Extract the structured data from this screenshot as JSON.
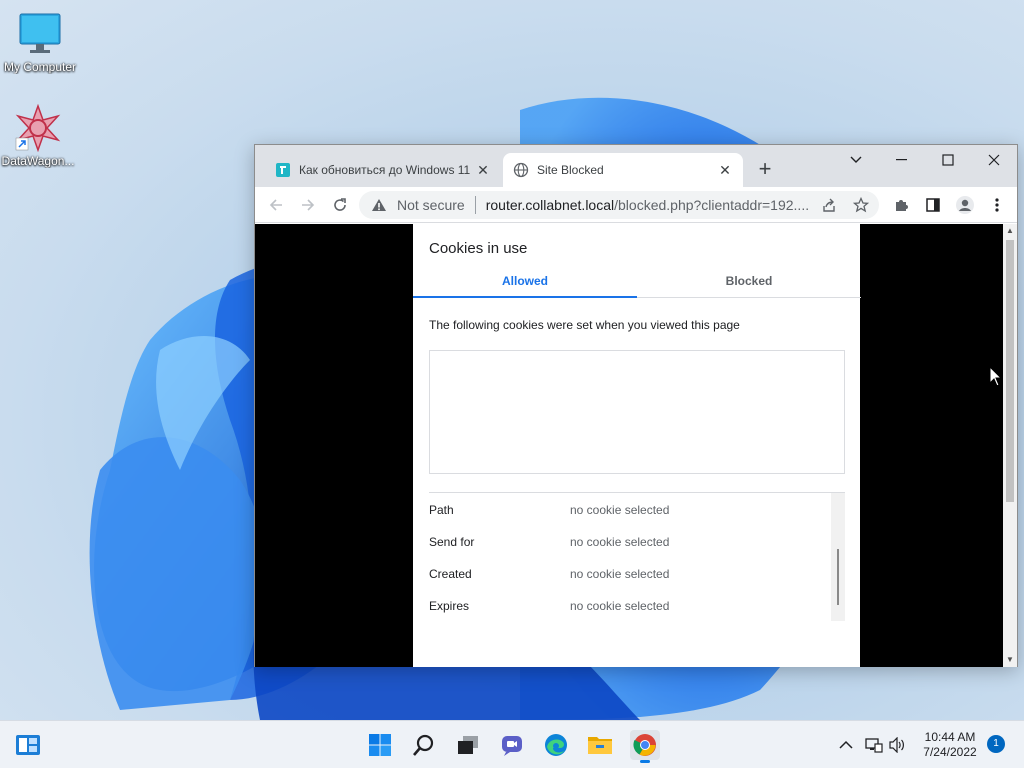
{
  "desktop": {
    "icons": [
      {
        "label": "My Computer",
        "icon": "monitor-icon"
      },
      {
        "label": "DataWagon...",
        "icon": "datawagon-app-icon"
      }
    ]
  },
  "browser": {
    "tabs": [
      {
        "title": "Как обновиться до Windows 11",
        "icon": "site-favicon",
        "active": false
      },
      {
        "title": "Site Blocked",
        "icon": "globe-icon",
        "active": true
      }
    ],
    "new_tab_label": "+",
    "address": {
      "security_label": "Not secure",
      "url_host": "router.collabnet.local",
      "url_path": "/blocked.php?clientaddr=192...."
    }
  },
  "cookies_dialog": {
    "title": "Cookies in use",
    "tabs": {
      "allowed": "Allowed",
      "blocked": "Blocked"
    },
    "description": "The following cookies were set when you viewed this page",
    "details": [
      {
        "key": "Path",
        "value": "no cookie selected"
      },
      {
        "key": "Send for",
        "value": "no cookie selected"
      },
      {
        "key": "Created",
        "value": "no cookie selected"
      },
      {
        "key": "Expires",
        "value": "no cookie selected"
      }
    ]
  },
  "taskbar": {
    "apps": [
      "widgets-icon",
      "start-icon",
      "search-icon",
      "task-view-icon",
      "chat-icon",
      "edge-icon",
      "file-explorer-icon",
      "chrome-icon"
    ],
    "clock": {
      "time": "10:44 AM",
      "date": "7/24/2022"
    },
    "notification_count": "1"
  },
  "colors": {
    "accent": "#1a73e8",
    "taskbar": "#eef2f7"
  }
}
